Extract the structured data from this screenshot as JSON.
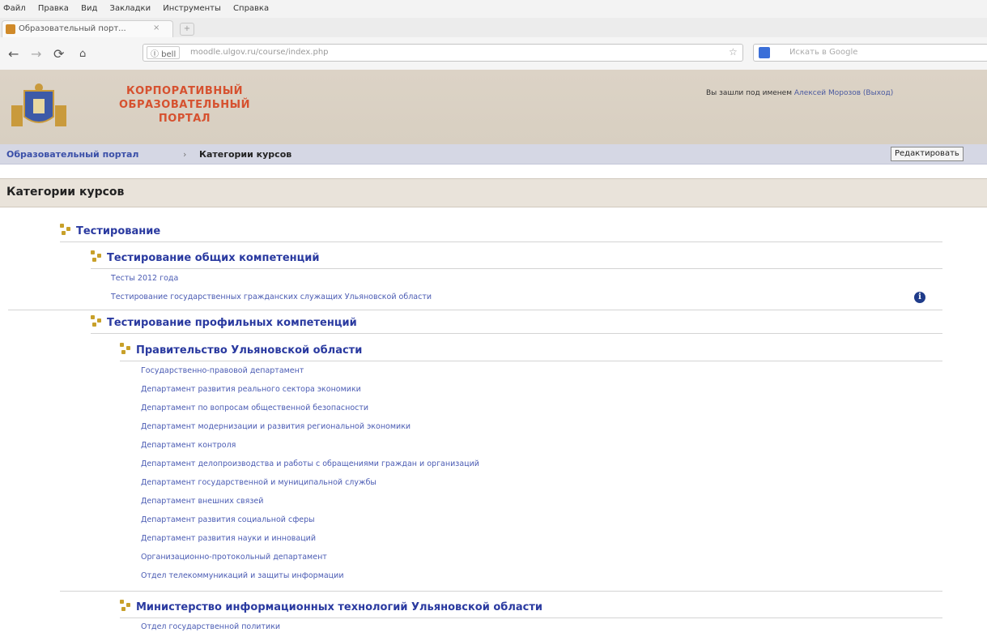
{
  "browser": {
    "menu": [
      "Файл",
      "Правка",
      "Вид",
      "Закладки",
      "Инструменты",
      "Справка"
    ],
    "tab_title": "Образовательный порт...",
    "tab_close": "×",
    "new_tab": "+",
    "identity": "Ⓘ bell",
    "url": "moodle.ulgov.ru/course/index.php",
    "search_placeholder": "Искать в Google"
  },
  "site": {
    "brand_line1": "КОРПОРАТИВНЫЙ",
    "brand_line2": "ОБРАЗОВАТЕЛЬНЫЙ",
    "brand_line3": "ПОРТАЛ",
    "login_prefix": "Вы зашли под именем",
    "login_user": "Алексей Морозов (Выход)",
    "breadcrumb_home": "Образовательный портал",
    "breadcrumb_sep": "›",
    "breadcrumb_current": "Категории курсов",
    "edit_button": "Редактировать"
  },
  "page": {
    "heading": "Категории курсов"
  },
  "tree": {
    "cat_testing": "Тестирование",
    "cat_general": "Тестирование общих компетенций",
    "general_items": [
      "Тесты 2012 года",
      "Тестирование государственных гражданских служащих Ульяновской области"
    ],
    "cat_profile": "Тестирование профильных компетенций",
    "cat_government": "Правительство Ульяновской области",
    "government_items": [
      "Государственно-правовой департамент",
      "Департамент развития реального сектора экономики",
      "Департамент по вопросам общественной безопасности",
      "Департамент модернизации и развития региональной экономики",
      "Департамент контроля",
      "Департамент делопроизводства и работы с обращениями граждан и организаций",
      "Департамент государственной и муниципальной службы",
      "Департамент внешних связей",
      "Департамент развития социальной сферы",
      "Департамент развития науки и инноваций",
      "Организационно-протокольный департамент",
      "Отдел телекоммуникаций и защиты информации"
    ],
    "cat_ministry": "Министерство информационных технологий Ульяновской области",
    "ministry_items": [
      "Отдел государственной политики"
    ],
    "info_icon_text": "i"
  }
}
